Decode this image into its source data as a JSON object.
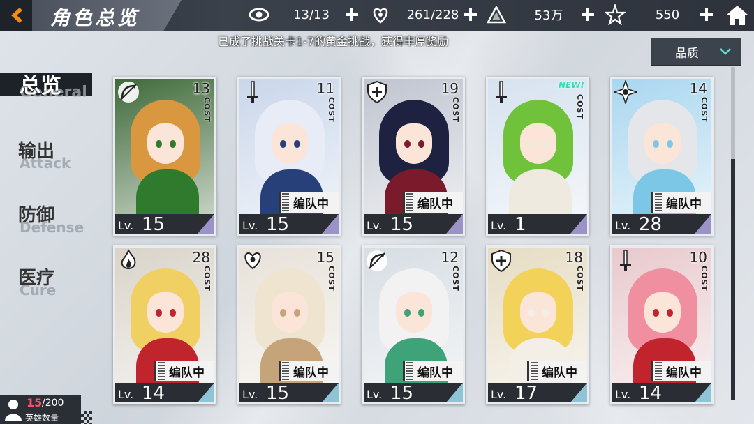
{
  "header": {
    "title": "角色总览",
    "resources": [
      {
        "icon": "eye-icon",
        "value": "13/13"
      },
      {
        "icon": "heart-hand-icon",
        "value": "261/228"
      },
      {
        "icon": "crystal-icon",
        "value": "53万"
      },
      {
        "icon": "star-icon",
        "value": "550"
      }
    ]
  },
  "ticker": {
    "text": "已成了挑战关卡1-7的黄金挑战，获得丰厚奖励"
  },
  "filter": {
    "label": "品质"
  },
  "categories": [
    {
      "cn": "总览",
      "en": "General"
    },
    {
      "cn": "输出",
      "en": "Attack"
    },
    {
      "cn": "防御",
      "en": "Defense"
    },
    {
      "cn": "医疗",
      "en": "Cure"
    }
  ],
  "card_labels": {
    "cost": "COST",
    "team": "编队中",
    "lv": "Lv.",
    "new": "NEW!"
  },
  "cards": [
    {
      "cost": "13",
      "level": "15",
      "in_team": false,
      "is_new": false,
      "class_icon": "bow-icon",
      "palette": {
        "bg": "#3f6a3a",
        "hair": "#d9983f",
        "body": "#2f7a2c"
      }
    },
    {
      "cost": "11",
      "level": "15",
      "in_team": true,
      "is_new": false,
      "class_icon": "sword-icon",
      "palette": {
        "bg": "#c9d6ea",
        "hair": "#e7ecf6",
        "body": "#27407a"
      }
    },
    {
      "cost": "19",
      "level": "15",
      "in_team": true,
      "is_new": false,
      "class_icon": "shield-icon",
      "palette": {
        "bg": "#bfc4cf",
        "hair": "#1e2240",
        "body": "#7a1a2a"
      }
    },
    {
      "cost": "",
      "level": "1",
      "in_team": false,
      "is_new": true,
      "class_icon": "sword-icon",
      "palette": {
        "bg": "#d6e2ef",
        "hair": "#6fc23a",
        "body": "#efeadf"
      }
    },
    {
      "cost": "14",
      "level": "28",
      "in_team": true,
      "is_new": false,
      "class_icon": "crystal-icon",
      "palette": {
        "bg": "#a9d6ef",
        "hair": "#e4e6ea",
        "body": "#7cc7e6"
      }
    },
    {
      "cost": "28",
      "level": "14",
      "in_team": true,
      "is_new": false,
      "class_icon": "flame-icon",
      "palette": {
        "bg": "#d9d3c9",
        "hair": "#f0cf63",
        "body": "#c0242d"
      }
    },
    {
      "cost": "15",
      "level": "15",
      "in_team": true,
      "is_new": false,
      "class_icon": "heart-hand-icon",
      "palette": {
        "bg": "#e7e1d8",
        "hair": "#efe4cf",
        "body": "#c6a47a"
      }
    },
    {
      "cost": "12",
      "level": "15",
      "in_team": true,
      "is_new": false,
      "class_icon": "bow-icon",
      "palette": {
        "bg": "#d6dde3",
        "hair": "#f2f2f2",
        "body": "#3fa37a"
      }
    },
    {
      "cost": "18",
      "level": "17",
      "in_team": true,
      "is_new": false,
      "class_icon": "shield-icon",
      "palette": {
        "bg": "#e6dcc3",
        "hair": "#f3d25a",
        "body": "#f4efe6"
      }
    },
    {
      "cost": "10",
      "level": "14",
      "in_team": true,
      "is_new": false,
      "class_icon": "sword-icon",
      "palette": {
        "bg": "#e8c9cd",
        "hair": "#ef8fa0",
        "body": "#c2242e"
      }
    }
  ],
  "hero_count": {
    "current": "15",
    "max": "/200",
    "label": "英雄数量"
  }
}
